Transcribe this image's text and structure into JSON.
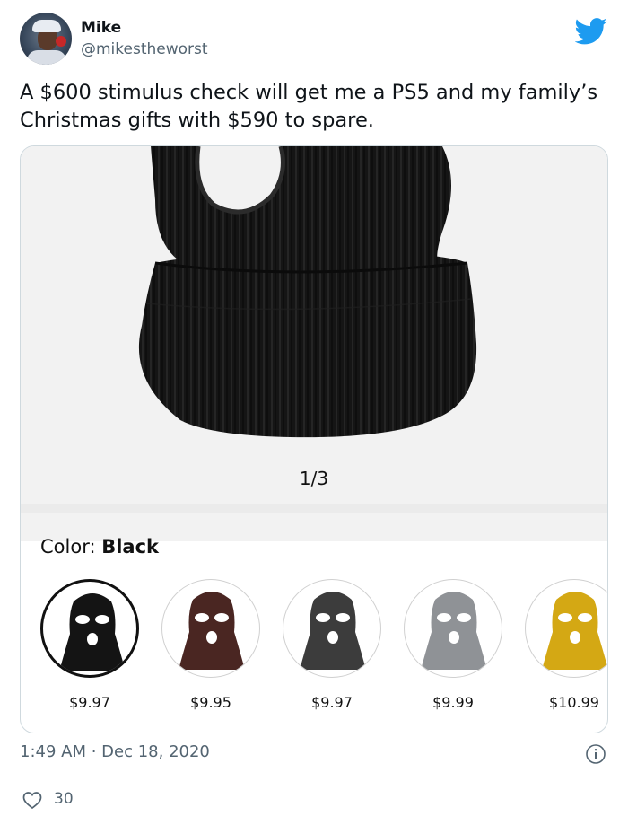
{
  "author": {
    "name": "Mike",
    "handle": "@mikestheworst",
    "avatar_icon": "avatar-photo",
    "platform_icon": "twitter-bird-icon"
  },
  "tweet": {
    "text": "A $600 stimulus check will get me a PS5 and my family’s Christmas gifts with $590 to spare."
  },
  "card": {
    "pager": "1/3",
    "color_label": "Color: ",
    "color_value": "Black",
    "variants": [
      {
        "color_name": "black",
        "hex": "#141414",
        "price": "$9.97"
      },
      {
        "color_name": "brown",
        "hex": "#4a2622",
        "price": "$9.95"
      },
      {
        "color_name": "dark-gray",
        "hex": "#3c3c3c",
        "price": "$9.97"
      },
      {
        "color_name": "light-gray",
        "hex": "#8f9296",
        "price": "$9.99"
      },
      {
        "color_name": "yellow",
        "hex": "#d4a814",
        "price": "$10.99"
      }
    ]
  },
  "meta": {
    "time": "1:49 AM",
    "separator": " · ",
    "date": "Dec 18, 2020",
    "like_count": "30"
  },
  "colors": {
    "twitter_blue": "#1d9bf0",
    "secondary_text": "#536471",
    "border": "#cfd9de"
  }
}
